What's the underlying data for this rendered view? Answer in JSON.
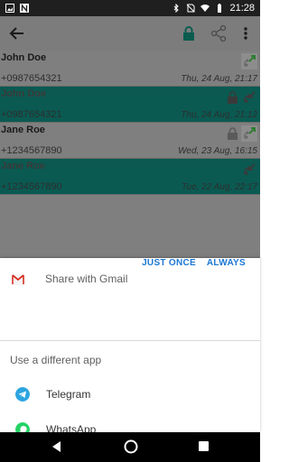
{
  "status_bar": {
    "time": "21:28"
  },
  "contacts": [
    {
      "name": "John Doe",
      "number": "+0987654321",
      "date": "Thu, 24 Aug, 21:17",
      "selected": false,
      "locked": false,
      "call": "outgoing"
    },
    {
      "name": "John Doe",
      "number": "+0987654321",
      "date": "Thu, 24 Aug, 21:12",
      "selected": true,
      "locked": true,
      "call": "missed"
    },
    {
      "name": "Jane Roe",
      "number": "+1234567890",
      "date": "Wed, 23 Aug, 16:15",
      "selected": false,
      "locked": true,
      "call": "outgoing"
    },
    {
      "name": "Jane Roe",
      "number": "+1234567890",
      "date": "Tue, 22 Aug, 22:17",
      "selected": true,
      "locked": false,
      "call": "missed"
    }
  ],
  "share_sheet": {
    "default_app": "Share with Gmail",
    "just_once": "JUST ONCE",
    "always": "ALWAYS",
    "different_app_label": "Use a different app",
    "apps": [
      {
        "name": "Telegram",
        "icon": "telegram-icon",
        "color": "#2ca5e0"
      },
      {
        "name": "WhatsApp",
        "icon": "whatsapp-icon",
        "color": "#25d366"
      }
    ]
  },
  "colors": {
    "selected_row": "#0a5a52",
    "accent": "#1976d2",
    "app_bar": "#7c7c7c",
    "lock": "#0b5c4f"
  }
}
